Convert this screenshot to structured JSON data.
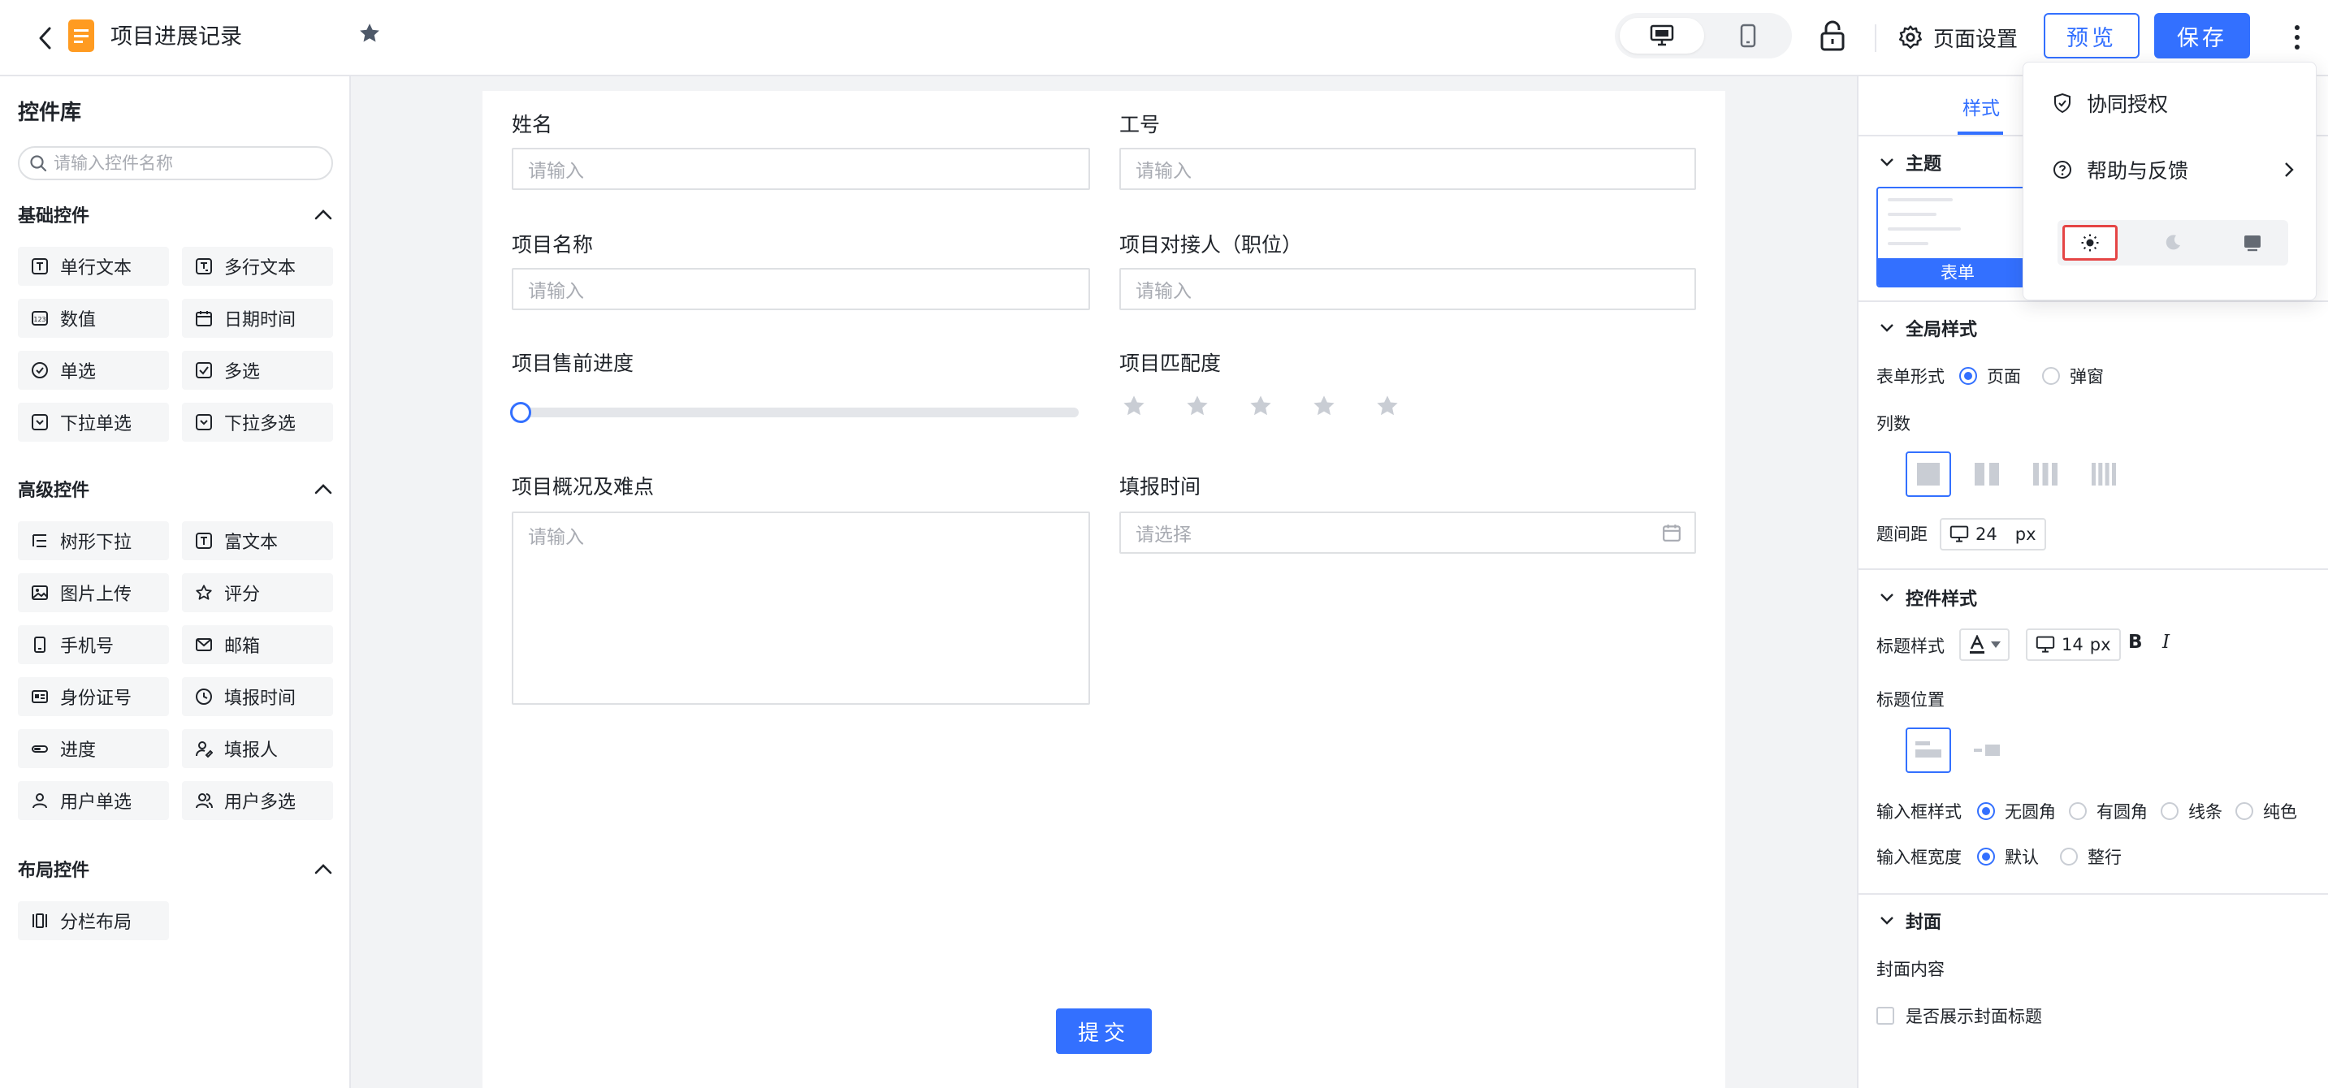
{
  "header": {
    "title": "项目进展记录",
    "page_settings_label": "页面设置",
    "preview_label": "预览",
    "save_label": "保存"
  },
  "left_panel": {
    "title": "控件库",
    "search_placeholder": "请输入控件名称",
    "sections": [
      {
        "title": "基础控件",
        "items": [
          "单行文本",
          "多行文本",
          "数值",
          "日期时间",
          "单选",
          "多选",
          "下拉单选",
          "下拉多选"
        ]
      },
      {
        "title": "高级控件",
        "items": [
          "树形下拉",
          "富文本",
          "图片上传",
          "评分",
          "手机号",
          "邮箱",
          "身份证号",
          "填报时间",
          "进度",
          "填报人",
          "用户单选",
          "用户多选"
        ]
      },
      {
        "title": "布局控件",
        "items": [
          "分栏布局"
        ]
      }
    ]
  },
  "form": {
    "fields": {
      "name": {
        "label": "姓名",
        "placeholder": "请输入"
      },
      "employee_id": {
        "label": "工号",
        "placeholder": "请输入"
      },
      "project_name": {
        "label": "项目名称",
        "placeholder": "请输入"
      },
      "project_contact": {
        "label": "项目对接人（职位）",
        "placeholder": "请输入"
      },
      "presale_progress": {
        "label": "项目售前进度",
        "value": 0
      },
      "match_degree": {
        "label": "项目匹配度",
        "stars_total": 5,
        "stars_selected": 0
      },
      "overview": {
        "label": "项目概况及难点",
        "placeholder": "请输入"
      },
      "report_time": {
        "label": "填报时间",
        "placeholder": "请选择"
      }
    },
    "submit_label": "提交"
  },
  "right_panel": {
    "tabs": [
      "样式"
    ],
    "theme": {
      "title": "主题",
      "thumb_label": "表单"
    },
    "global_style": {
      "title": "全局样式",
      "form_type_label": "表单形式",
      "form_type_options": [
        "页面",
        "弹窗"
      ],
      "form_type_selected": "页面",
      "columns_label": "列数",
      "columns_selected": 1,
      "spacing_label": "题间距",
      "spacing_value": "24",
      "spacing_unit": "px"
    },
    "control_style": {
      "title": "控件样式",
      "title_style_label": "标题样式",
      "font_size_value": "14",
      "font_size_unit": "px",
      "bold_label": "B",
      "italic_label": "I",
      "title_position_label": "标题位置",
      "input_style_label": "输入框样式",
      "input_style_options": [
        "无圆角",
        "有圆角",
        "线条",
        "纯色"
      ],
      "input_style_selected": "无圆角",
      "input_width_label": "输入框宽度",
      "input_width_options": [
        "默认",
        "整行"
      ],
      "input_width_selected": "默认"
    },
    "cover": {
      "title": "封面",
      "content_label": "封面内容",
      "show_title_label": "是否展示封面标题"
    }
  },
  "dropdown_menu": {
    "items": [
      "协同授权",
      "帮助与反馈"
    ],
    "theme_options": [
      "light",
      "dark",
      "auto"
    ],
    "theme_selected": "light"
  },
  "colors": {
    "accent": "#3370ff",
    "highlight_border": "#e54545"
  }
}
